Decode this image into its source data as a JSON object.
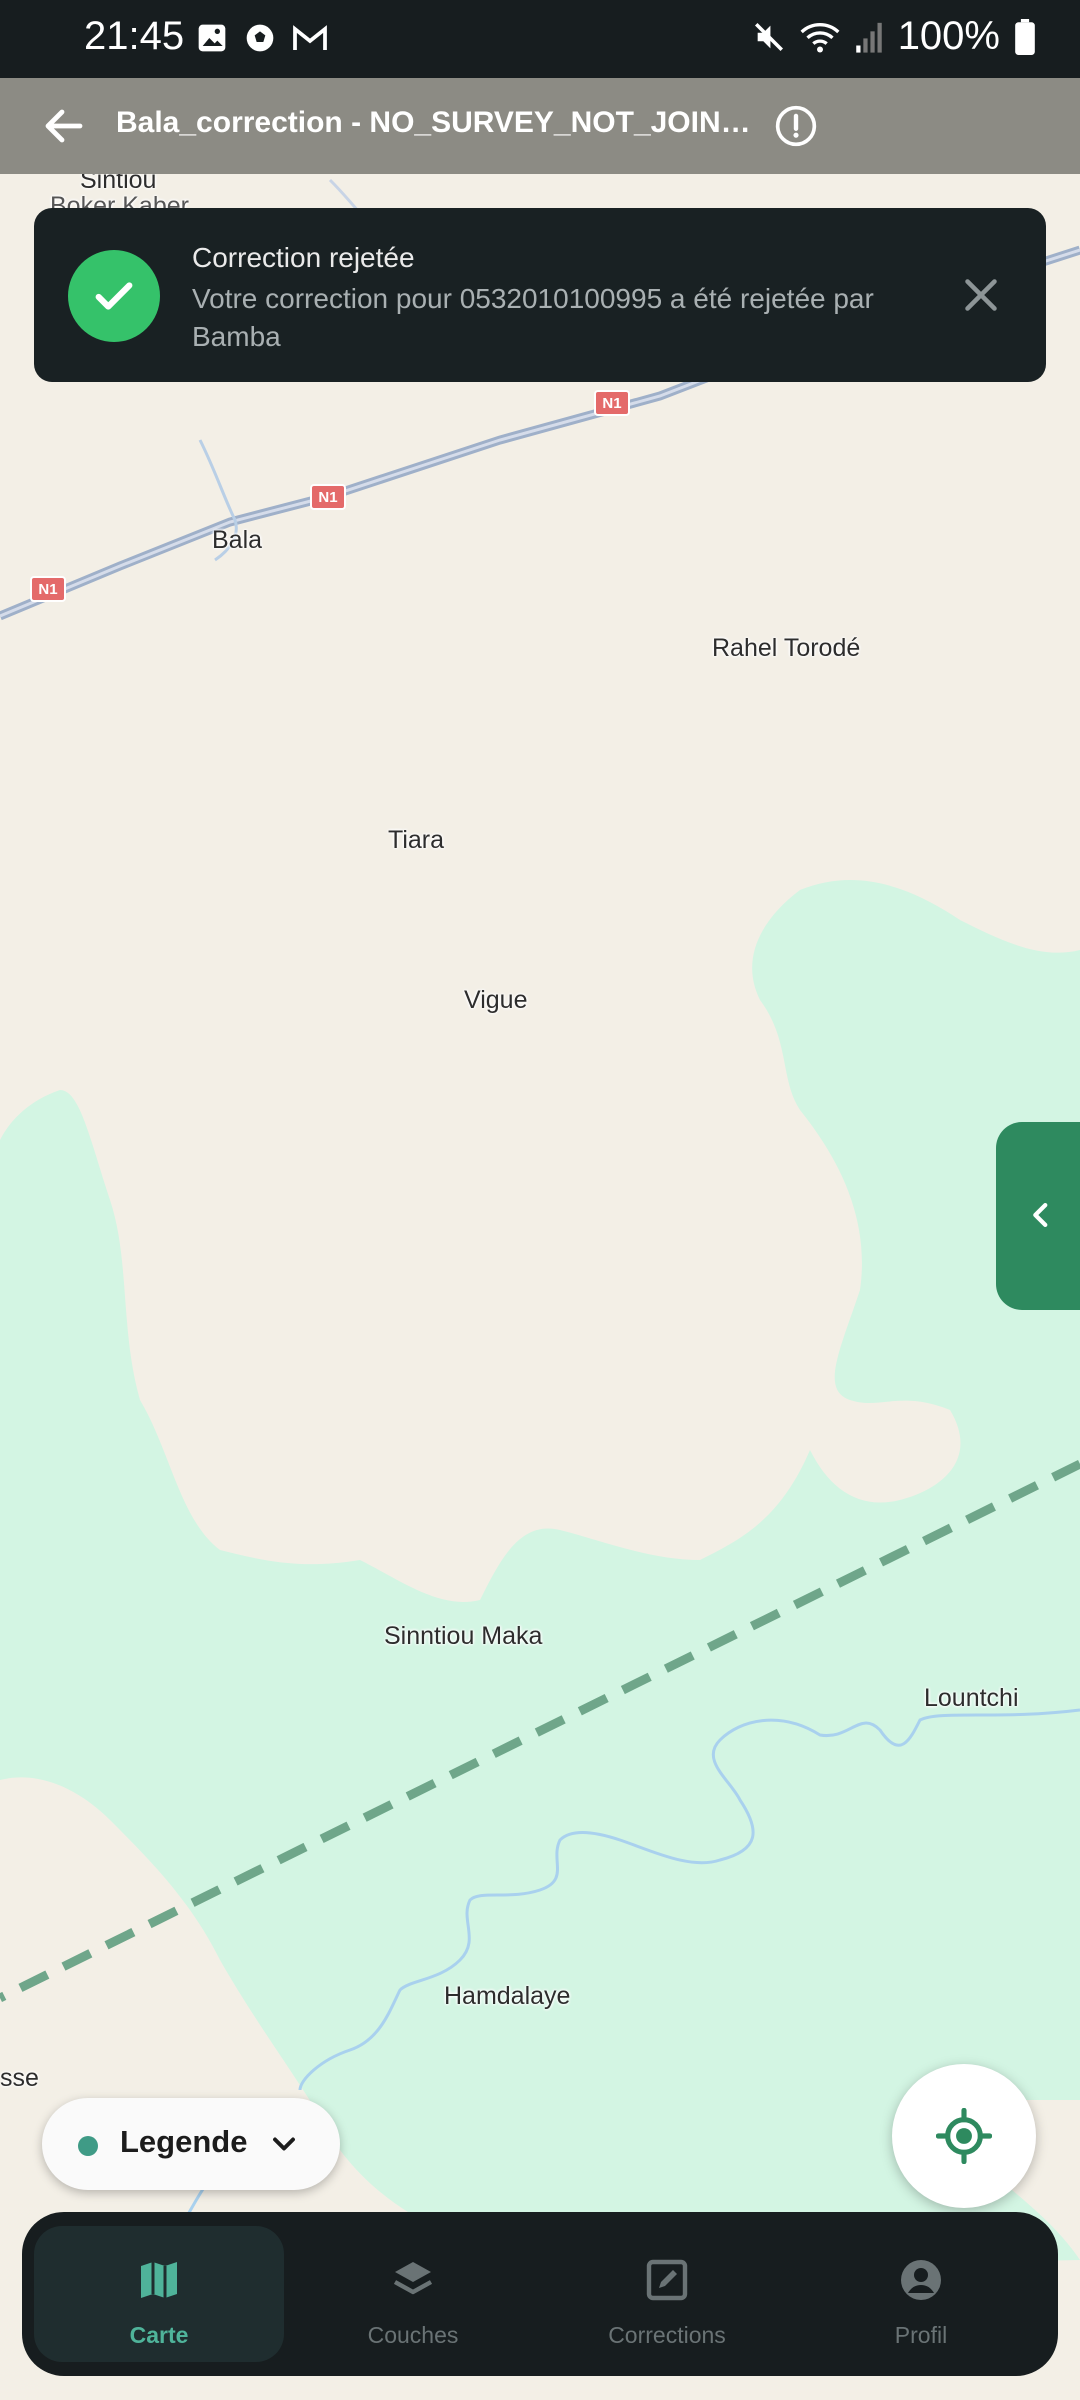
{
  "status_bar": {
    "time": "21:45",
    "battery": "100%",
    "icons": [
      "image-icon",
      "soccer-ball-icon",
      "gmail-icon",
      "mute-icon",
      "wifi-icon",
      "signal-icon",
      "battery-icon"
    ]
  },
  "app_bar": {
    "title": "Bala_correction - NO_SURVEY_NOT_JOINED...",
    "icons": [
      "back-arrow-icon",
      "info-icon"
    ]
  },
  "notification": {
    "title": "Correction rejetée",
    "message": "Votre correction pour 0532010100995 a été rejetée par Bamba"
  },
  "map": {
    "places": [
      "Sintiou",
      "Boker Kaber",
      "Bala",
      "Rahel Torodé",
      "Tiara",
      "Vigue",
      "Sinntiou Maka",
      "Lountchi",
      "Hamdalaye",
      "sse"
    ],
    "road_badges": [
      "N1",
      "N1",
      "N1"
    ],
    "colors": {
      "land": "#f3efe6",
      "forest": "#d3f5e3",
      "road": "#9fb0c9",
      "river": "#a9d1ee",
      "boundary": "#6fa68a"
    }
  },
  "legend": {
    "label": "Legende"
  },
  "bottom_nav": {
    "items": [
      {
        "label": "Carte",
        "icon": "map-icon",
        "active": true
      },
      {
        "label": "Couches",
        "icon": "layers-icon",
        "active": false
      },
      {
        "label": "Corrections",
        "icon": "edit-icon",
        "active": false
      },
      {
        "label": "Profil",
        "icon": "account-icon",
        "active": false
      }
    ]
  },
  "colors": {
    "accent": "#2e8a5f",
    "success": "#35c26a",
    "nav_active": "#4fb39a",
    "nav_inactive": "#6a7375"
  }
}
